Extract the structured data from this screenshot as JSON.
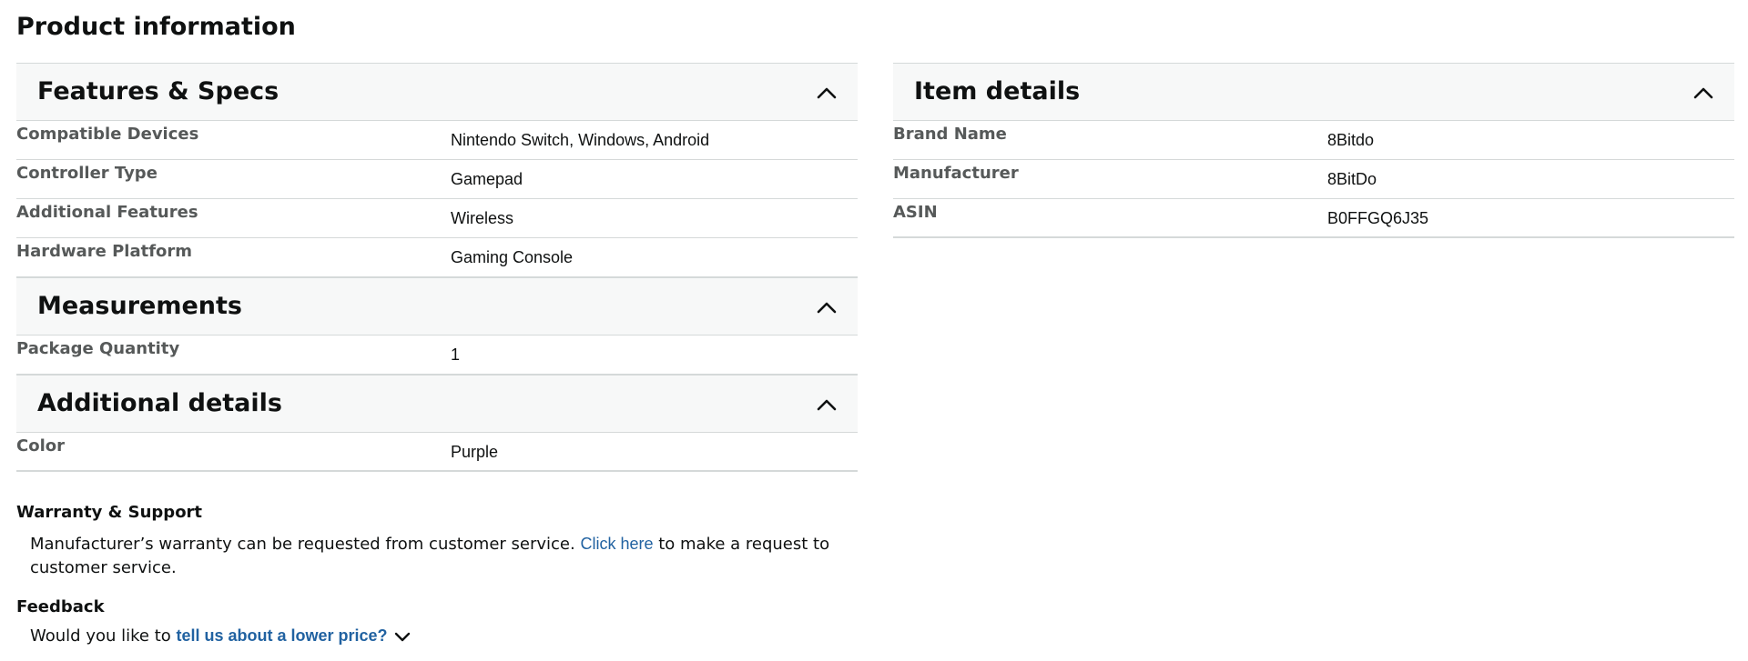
{
  "page_title": "Product information",
  "left": {
    "sections": [
      {
        "title": "Features & Specs",
        "rows": [
          {
            "label": "Compatible Devices",
            "value": "Nintendo Switch, Windows, Android"
          },
          {
            "label": "Controller Type",
            "value": "Gamepad"
          },
          {
            "label": "Additional Features",
            "value": "Wireless"
          },
          {
            "label": "Hardware Platform",
            "value": "Gaming Console"
          }
        ]
      },
      {
        "title": "Measurements",
        "rows": [
          {
            "label": "Package Quantity",
            "value": "1"
          }
        ]
      },
      {
        "title": "Additional details",
        "rows": [
          {
            "label": "Color",
            "value": "Purple"
          }
        ]
      }
    ]
  },
  "right": {
    "sections": [
      {
        "title": "Item details",
        "rows": [
          {
            "label": "Brand Name",
            "value": "8Bitdo"
          },
          {
            "label": "Manufacturer",
            "value": "8BitDo"
          },
          {
            "label": "ASIN",
            "value": "B0FFGQ6J35"
          }
        ]
      }
    ]
  },
  "warranty": {
    "heading": "Warranty & Support",
    "text_before": "Manufacturer’s warranty can be requested from customer service. ",
    "link": "Click here",
    "text_after": " to make a request to customer service."
  },
  "feedback": {
    "heading": "Feedback",
    "text_before": "Would you like to ",
    "link": "tell us about a lower price?"
  },
  "icons": {
    "section_toggle": "chevron-up-icon",
    "feedback_toggle": "chevron-down-icon"
  },
  "colors": {
    "header_bg": "#f7f8f8",
    "border": "#d5d9d9",
    "label": "#565959",
    "link": "#2162a1"
  }
}
